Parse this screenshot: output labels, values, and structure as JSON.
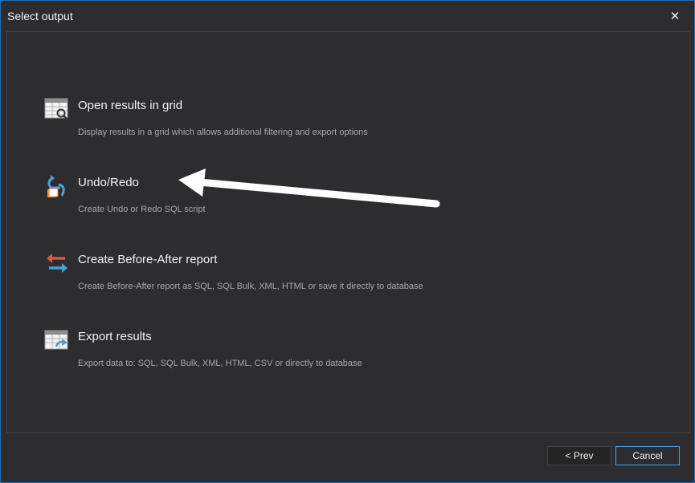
{
  "window": {
    "title": "Select output",
    "close_glyph": "✕"
  },
  "options": [
    {
      "label": "Open results in grid",
      "description": "Display results in a grid which allows additional filtering and export options",
      "icon": "grid-search-icon"
    },
    {
      "label": "Undo/Redo",
      "description": "Create Undo or Redo SQL script",
      "icon": "undo-redo-icon"
    },
    {
      "label": "Create Before-After report",
      "description": "Create Before-After report as SQL, SQL Bulk, XML, HTML or save it directly to database",
      "icon": "before-after-arrows-icon"
    },
    {
      "label": "Export results",
      "description": "Export data to: SQL, SQL Bulk, XML, HTML, CSV or directly to database",
      "icon": "export-grid-icon"
    }
  ],
  "footer": {
    "prev_label": "< Prev",
    "cancel_label": "Cancel"
  },
  "colors": {
    "background": "#2d2d30",
    "window_border": "#1e6fb5",
    "accent_blue": "#4a9fd8",
    "accent_orange": "#e07b39",
    "accent_red": "#d9573b"
  }
}
